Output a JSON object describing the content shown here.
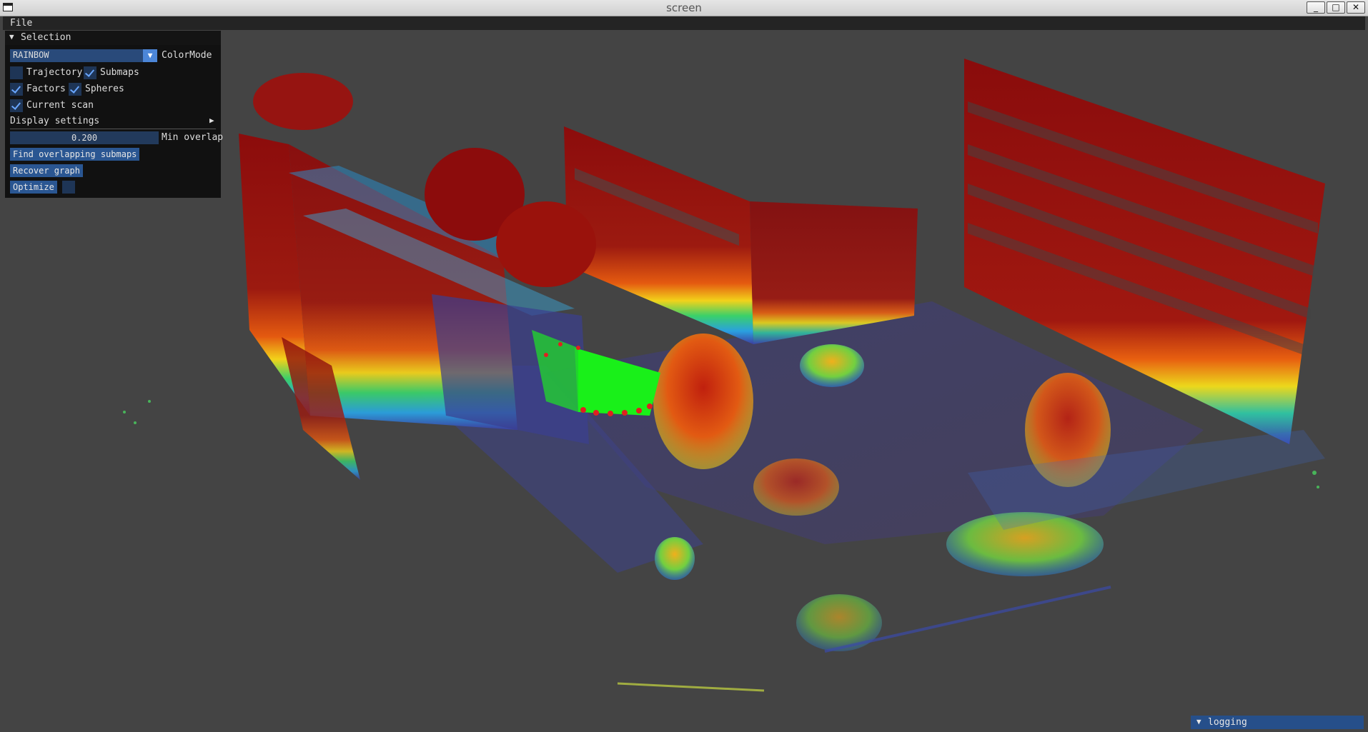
{
  "window": {
    "title": "screen"
  },
  "menubar": {
    "file": "File"
  },
  "panel": {
    "header": "Selection",
    "color_mode_value": "RAINBOW",
    "color_mode_label": "ColorMode",
    "checkboxes": [
      {
        "label": "Trajectory",
        "checked": false
      },
      {
        "label": "Submaps",
        "checked": true
      },
      {
        "label": "Factors",
        "checked": true
      },
      {
        "label": "Spheres",
        "checked": true
      },
      {
        "label": "Current scan",
        "checked": true
      }
    ],
    "display_settings": "Display settings",
    "min_overlap_value": "0.200",
    "min_overlap_label": "Min overlap",
    "find_button": "Find overlapping submaps",
    "recover_button": "Recover graph",
    "optimize_button": "Optimize",
    "optimize_checked": false
  },
  "logging": {
    "label": "logging"
  },
  "icons": {
    "arrow_down": "▼",
    "arrow_right": "▶",
    "minimize": "_",
    "maximize": "□",
    "close": "✕"
  },
  "colors": {
    "background": "#444444",
    "panel": "#0e0e0e",
    "accent": "#4c86d8",
    "button": "#2a5692"
  }
}
